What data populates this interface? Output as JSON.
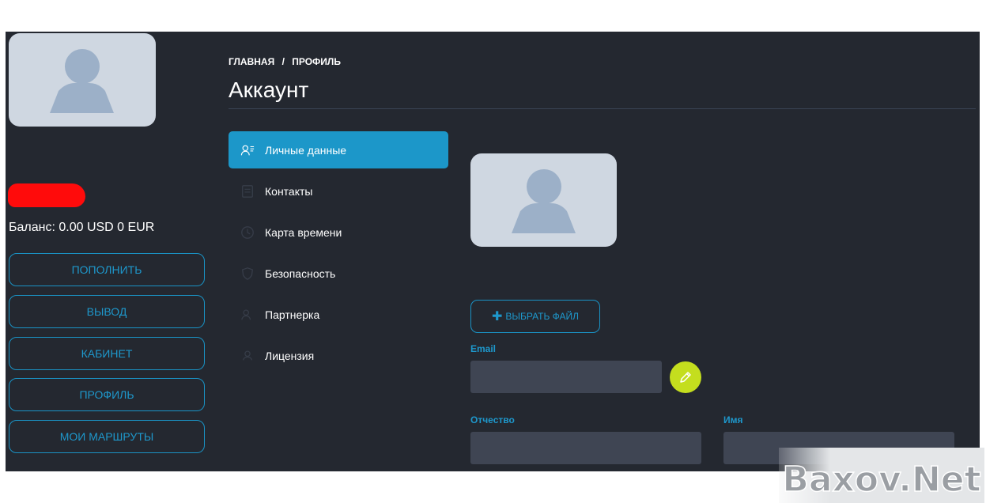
{
  "sidebar": {
    "balance": "Баланс: 0.00 USD 0 EUR",
    "buttons": [
      {
        "label": "ПОПОЛНИТЬ"
      },
      {
        "label": "ВЫВОД"
      },
      {
        "label": "КАБИНЕТ"
      },
      {
        "label": "ПРОФИЛЬ"
      },
      {
        "label": "МОИ МАРШРУТЫ"
      }
    ]
  },
  "header": {
    "breadcrumb": {
      "home": "ГЛАВНАЯ",
      "separator": "/",
      "current": "ПРОФИЛЬ"
    },
    "title": "Аккаунт"
  },
  "menu": {
    "items": [
      {
        "label": "Личные данные",
        "icon": "user-list-icon",
        "active": true
      },
      {
        "label": "Контакты",
        "icon": "contacts-icon",
        "active": false
      },
      {
        "label": "Карта времени",
        "icon": "clock-icon",
        "active": false
      },
      {
        "label": "Безопасность",
        "icon": "shield-icon",
        "active": false
      },
      {
        "label": "Партнерка",
        "icon": "partners-icon",
        "active": false
      },
      {
        "label": "Лицензия",
        "icon": "license-icon",
        "active": false
      }
    ]
  },
  "profile": {
    "choose_file_label": "ВЫБРАТЬ ФАЙЛ",
    "fields": {
      "email": {
        "label": "Email",
        "value": ""
      },
      "patronymic": {
        "label": "Отчество",
        "value": ""
      },
      "first_name": {
        "label": "Имя",
        "value": ""
      }
    }
  },
  "watermark": {
    "text": "Baxov.Net"
  },
  "colors": {
    "background": "#242830",
    "accent": "#1c97c9",
    "field": "#3f4553",
    "edit_button": "#c4de1e",
    "redaction": "#ff0b0b"
  }
}
